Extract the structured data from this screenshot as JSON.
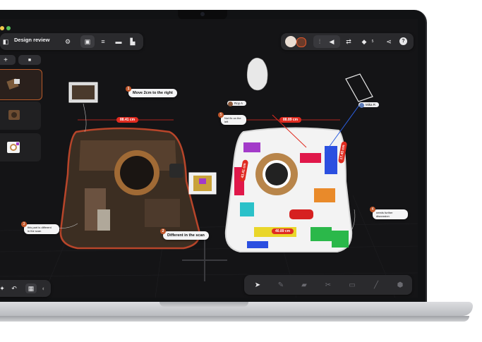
{
  "app": {
    "title": "Design review"
  },
  "colors": {
    "accent": "#c0562a",
    "measure": "#e02b20",
    "window_bg": "#141416",
    "panel": "#2a2a2d"
  },
  "toolbar": {
    "icons": [
      "sidebar-toggle-icon",
      "gear-icon",
      "toolbox-icon",
      "list-icon",
      "folder-icon",
      "box-icon"
    ]
  },
  "right_toolbar": {
    "icons": [
      "avatar",
      "avatar",
      "equalizer-icon",
      "play-back-icon",
      "shuffle-icon",
      "tag-icon",
      "share-icon",
      "help-icon"
    ],
    "tag_count": "5"
  },
  "sidebar": {
    "buttons": [
      "+",
      "■"
    ],
    "thumbs": [
      {
        "selected": true
      },
      {
        "selected": false
      },
      {
        "selected": false
      }
    ]
  },
  "annotations": [
    {
      "num": "1",
      "text": "Move 2cm to the right"
    },
    {
      "num": "2",
      "text": "Different in the scan"
    },
    {
      "num": "3",
      "text": "this part is different\nin the scan"
    },
    {
      "num": "4",
      "text": "needs further\ndiscussion"
    },
    {
      "num": "5",
      "text": "Not fix on the\nleft"
    }
  ],
  "measurements": [
    "88.41 cm",
    "88.89 cm",
    "40.89 cm",
    "17.45 cm",
    "43.41 cm"
  ],
  "users": [
    "Roy A",
    "Mika R"
  ],
  "bottom_tools": [
    "cursor-icon",
    "pen-icon",
    "comment-icon",
    "scissors-icon",
    "frame-icon",
    "brush-icon",
    "cube-icon"
  ],
  "bottom_left": [
    "pin-icon",
    "undo-icon",
    "grid-icon",
    "half-icon"
  ]
}
